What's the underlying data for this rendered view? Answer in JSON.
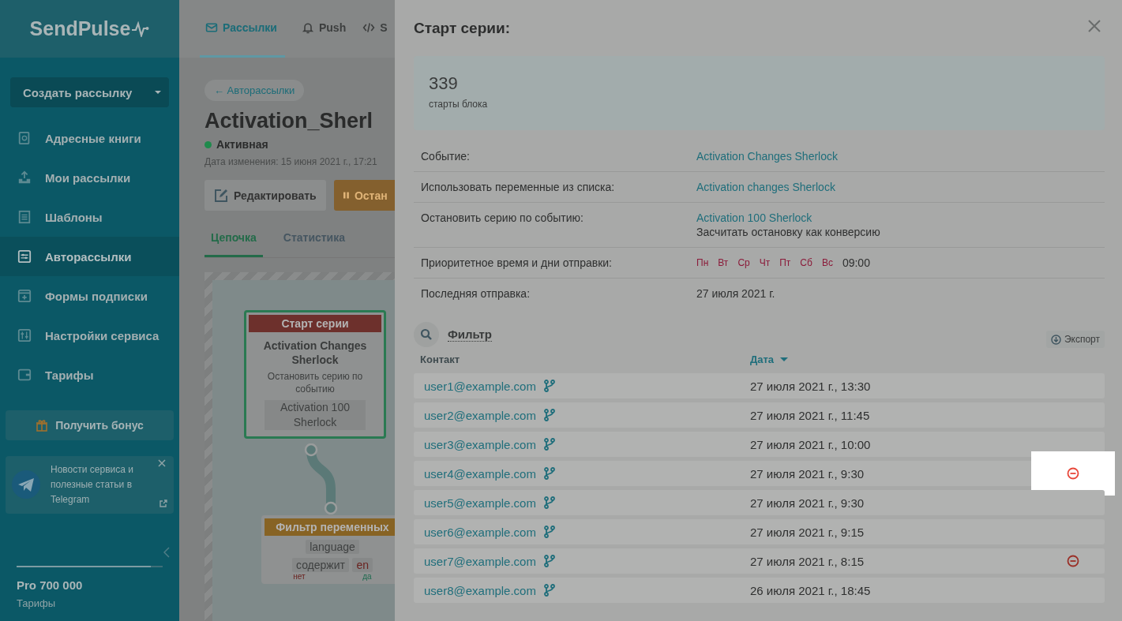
{
  "sidebar": {
    "logo": "SendPulse",
    "create_button": "Создать рассылку",
    "items": [
      {
        "label": "Адресные книги",
        "selected": false
      },
      {
        "label": "Мои рассылки",
        "selected": false
      },
      {
        "label": "Шаблоны",
        "selected": false
      },
      {
        "label": "Авторассылки",
        "selected": true
      },
      {
        "label": "Формы подписки",
        "selected": false
      },
      {
        "label": "Настройки сервиса",
        "selected": false
      },
      {
        "label": "Тарифы",
        "selected": false
      }
    ],
    "bonus_button": "Получить бонус",
    "telegram_card": {
      "text": "Новости сервиса и полезные статьи в Telegram"
    },
    "plan": {
      "name": "Pro 700 000",
      "link": "Тарифы",
      "level": 0.92
    }
  },
  "top_tabs": [
    {
      "label": "Рассылки",
      "selected": true
    },
    {
      "label": "Push",
      "selected": false
    },
    {
      "label": "S",
      "selected": false
    }
  ],
  "page": {
    "back_link": "← Авторассылки",
    "title": "Activation_Sherl",
    "status": "Активная",
    "modified": "Дата изменения: 15 июня 2021 г., 17:21",
    "buttons": [
      {
        "label": "Редактировать",
        "kind": "edit"
      },
      {
        "label": "Остан",
        "kind": "pause"
      }
    ],
    "tabs": [
      {
        "label": "Цепочка",
        "selected": true
      },
      {
        "label": "Статистика",
        "selected": false
      }
    ]
  },
  "diagram": {
    "start_node": {
      "header": "Старт серии",
      "event": "Activation Changes Sherlock",
      "stop_label": "Остановить серию по событию",
      "stop_event": "Activation 100 Sherlock"
    },
    "filter_node": {
      "header": "Фильтр переменных",
      "variable": "language",
      "operator": "содержит",
      "value": "en",
      "no": "нет",
      "yes": "да"
    }
  },
  "panel": {
    "title": "Старт серии:",
    "stats": {
      "value": "339",
      "label": "старты блока"
    },
    "info": [
      {
        "label": "Событие:",
        "kind": "link",
        "value": "Activation Changes Sherlock"
      },
      {
        "label": "Использовать переменные из списка:",
        "kind": "link",
        "value": "Activation changes Sherlock"
      },
      {
        "label": "Остановить серию по событию:",
        "kind": "link",
        "value": "Activation 100 Sherlock",
        "note": "Засчитать остановку как конверсию"
      },
      {
        "label": "Приоритетное время и дни отправки:",
        "kind": "days",
        "days": [
          "Пн",
          "Вт",
          "Ср",
          "Чт",
          "Пт",
          "Сб",
          "Вс"
        ],
        "value": "09:00"
      },
      {
        "label": "Последняя отправка:",
        "kind": "text",
        "value": "27 июля 2021 г."
      }
    ],
    "filter_label": "Фильтр",
    "export_button": "Экспорт",
    "columns": [
      "Контакт",
      "Дата"
    ],
    "rows": [
      {
        "contact": "user1@example.com",
        "date": "27 июля 2021 г., 13:30",
        "remove": false,
        "highlighted": false
      },
      {
        "contact": "user2@example.com",
        "date": "27 июля 2021 г., 11:45",
        "remove": false,
        "highlighted": false
      },
      {
        "contact": "user3@example.com",
        "date": "27 июля 2021 г., 10:00",
        "remove": false,
        "highlighted": false
      },
      {
        "contact": "user4@example.com",
        "date": "27 июля 2021 г., 9:30",
        "remove": true,
        "highlighted": true
      },
      {
        "contact": "user5@example.com",
        "date": "27 июля 2021 г., 9:30",
        "remove": false,
        "highlighted": false
      },
      {
        "contact": "user6@example.com",
        "date": "27 июля 2021 г., 9:15",
        "remove": false,
        "highlighted": false
      },
      {
        "contact": "user7@example.com",
        "date": "27 июля 2021 г., 8:15",
        "remove": true,
        "highlighted": false
      },
      {
        "contact": "user8@example.com",
        "date": "26 июля 2021 г., 18:45",
        "remove": false,
        "highlighted": false
      }
    ]
  }
}
